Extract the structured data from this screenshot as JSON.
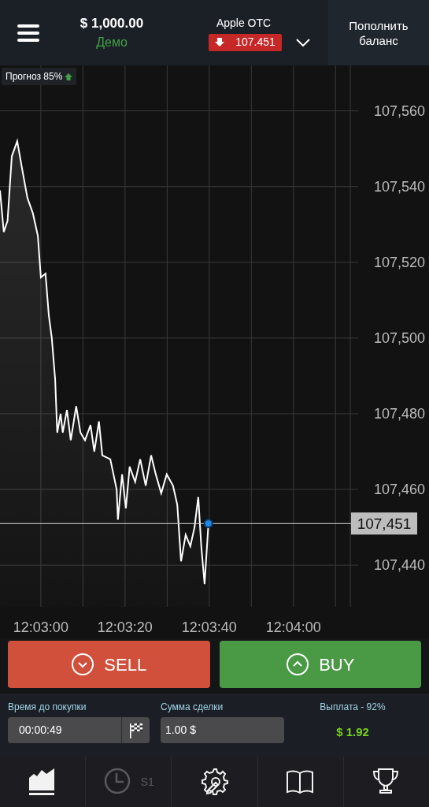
{
  "header": {
    "balance": "$ 1,000.00",
    "account_type": "Демо",
    "asset": "Apple OTC",
    "price": "107.451",
    "price_falling": true,
    "deposit_button": "Пополнить баланс"
  },
  "forecast": {
    "label": "Прогноз",
    "percent": "85%",
    "rising": true
  },
  "chart": {
    "current_price_label": "107,451",
    "chart_data": {
      "type": "area",
      "grid": true,
      "ref_lines": [
        {
          "axis": "y",
          "value": 107451
        }
      ],
      "x": [
        43370.3,
        43371.2,
        43372.1,
        43373.1,
        43374.4,
        43375.5,
        43376.8,
        43378.1,
        43379.3,
        43380,
        43381.1,
        43381.9,
        43382.6,
        43383.4,
        43383.9,
        43384.7,
        43385.2,
        43386.2,
        43387.1,
        43388.4,
        43389.4,
        43390.5,
        43391.8,
        43392.7,
        43393.8,
        43394.6,
        43396.5,
        43398.0,
        43398.3,
        43399.3,
        43400.2,
        43401.1,
        43402.4,
        43403.6,
        43404.9,
        43406.2,
        43407.3,
        43408.6,
        43409.9,
        43411.4,
        43412.4,
        43413.3,
        43414.4,
        43415.5,
        43416.5,
        43417.4,
        43418.1,
        43418.9,
        43419.8
      ],
      "series": [
        {
          "color": "#ffffff",
          "values": [
            107539,
            107528,
            107531,
            107548,
            107552,
            107545,
            107537,
            107533,
            107527,
            107516,
            107517,
            107506,
            107500,
            107489,
            107475,
            107480,
            107475,
            107481,
            107473,
            107482,
            107475,
            107473,
            107477,
            107470,
            107478,
            107469,
            107468,
            107460,
            107452,
            107464,
            107455,
            107466,
            107462,
            107468,
            107461,
            107469,
            107464,
            107459,
            107464,
            107461,
            107456,
            107441,
            107448,
            107445,
            107450,
            107458,
            107445,
            107435,
            107451
          ]
        }
      ],
      "xlim": [
        43370.3,
        43453.5
      ],
      "ylim": [
        107429,
        107572
      ],
      "xticks": [
        {
          "value": 43380,
          "label": "12:03:00"
        },
        {
          "value": 43400,
          "label": "12:03:20"
        },
        {
          "value": 43420,
          "label": "12:03:40"
        },
        {
          "value": 43440,
          "label": "12:04:00"
        }
      ],
      "yticks": [
        {
          "value": 107440,
          "label": "107,440"
        },
        {
          "value": 107460,
          "label": "107,460"
        },
        {
          "value": 107480,
          "label": "107,480"
        },
        {
          "value": 107500,
          "label": "107,500"
        },
        {
          "value": 107520,
          "label": "107,520"
        },
        {
          "value": 107540,
          "label": "107,540"
        },
        {
          "value": 107560,
          "label": "107,560"
        }
      ]
    }
  },
  "trade_buttons": [
    {
      "kind": "sell",
      "label": "SELL"
    },
    {
      "kind": "buy",
      "label": "BUY"
    }
  ],
  "time_field": {
    "label": "Время до покупки",
    "value": "00:00:49"
  },
  "amount_field": {
    "label": "Сумма сделки",
    "value": "1.00 $"
  },
  "payout": {
    "label": "Выплата - 92%",
    "value": "$ 1.92"
  },
  "nav": [
    {
      "disabled": false
    },
    {
      "disabled": true,
      "label": "S1"
    },
    {
      "disabled": false
    },
    {
      "disabled": false
    },
    {
      "disabled": false
    }
  ]
}
